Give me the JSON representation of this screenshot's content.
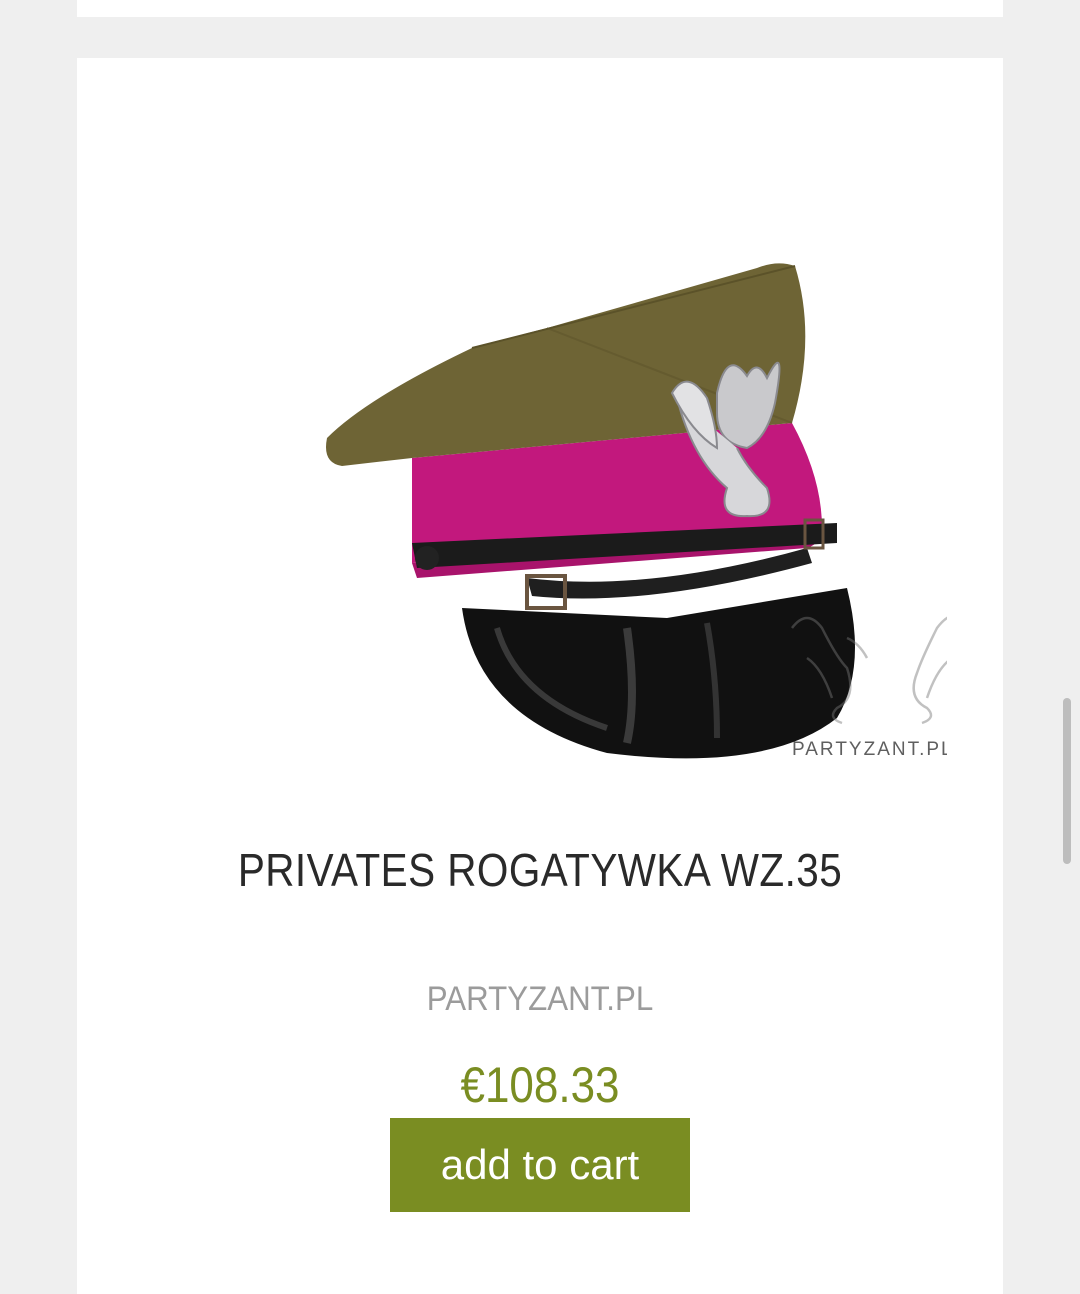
{
  "product": {
    "title": "PRIVATES ROGATYWKA WZ.35",
    "vendor": "PARTYZANT.PL",
    "price": "€108.33",
    "image_watermark": "PARTYZANT.PL",
    "add_to_cart_label": "add to cart"
  },
  "colors": {
    "accent": "#7a8d22",
    "cap_khaki": "#6e6435",
    "cap_band": "#c2187d",
    "visor": "#111111"
  }
}
